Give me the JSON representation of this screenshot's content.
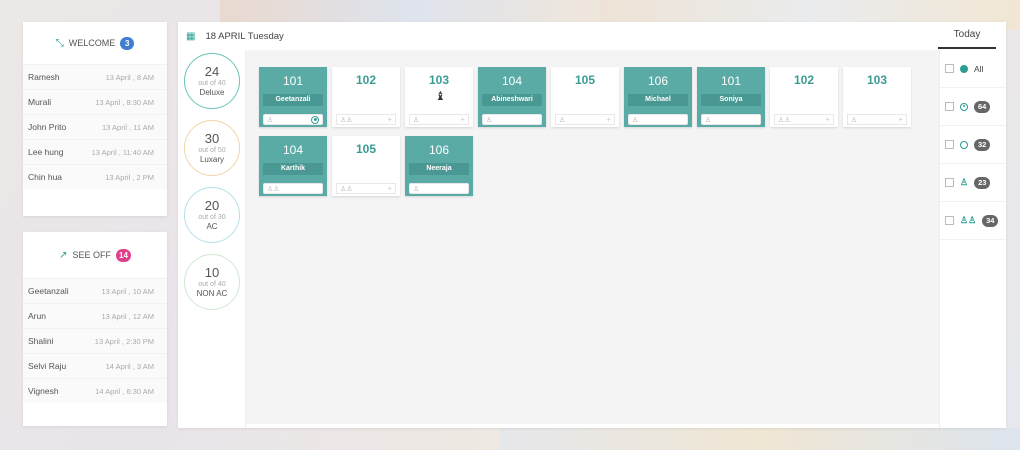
{
  "welcome": {
    "title": "WELCOME",
    "count": "3",
    "guests": [
      {
        "name": "Ramesh",
        "time": "13 April , 8 AM"
      },
      {
        "name": "Murali",
        "time": "13 April , 8:30 AM"
      },
      {
        "name": "John Prito",
        "time": "13 April , 11 AM"
      },
      {
        "name": "Lee hung",
        "time": "13 April , 11:40 AM"
      },
      {
        "name": "Chin hua",
        "time": "13 April , 2 PM"
      }
    ]
  },
  "seeoff": {
    "title": "SEE OFF",
    "count": "14",
    "guests": [
      {
        "name": "Geetanzali",
        "time": "13 April , 10 AM"
      },
      {
        "name": "Arun",
        "time": "13 April , 12 AM"
      },
      {
        "name": "Shalini",
        "time": "13 April , 2:30 PM"
      },
      {
        "name": "Selvi Raju",
        "time": "14 April , 3 AM"
      },
      {
        "name": "Vignesh",
        "time": "14 April , 6:30 AM"
      }
    ]
  },
  "header": {
    "date": "18 APRIL Tuesday",
    "today_tab": "Today"
  },
  "categories": [
    {
      "count": "24",
      "out_of": "out of 40",
      "name": "Deluxe"
    },
    {
      "count": "30",
      "out_of": "out of 50",
      "name": "Luxary"
    },
    {
      "count": "20",
      "out_of": "out of 30",
      "name": "AC"
    },
    {
      "count": "10",
      "out_of": "out of 40",
      "name": "NON AC"
    }
  ],
  "rooms_row1": [
    {
      "number": "101",
      "guest": "Geetanzali",
      "occupied": true
    },
    {
      "number": "102",
      "guest": "",
      "occupied": false
    },
    {
      "number": "103",
      "guest": "",
      "occupied": false
    },
    {
      "number": "104",
      "guest": "Abineshwari",
      "occupied": true
    },
    {
      "number": "105",
      "guest": "",
      "occupied": false
    },
    {
      "number": "106",
      "guest": "Michael",
      "occupied": true
    },
    {
      "number": "101",
      "guest": "Soniya",
      "occupied": true
    },
    {
      "number": "102",
      "guest": "",
      "occupied": false
    },
    {
      "number": "103",
      "guest": "",
      "occupied": false
    }
  ],
  "rooms_row2": [
    {
      "number": "104",
      "guest": "Karthik",
      "occupied": true
    },
    {
      "number": "105",
      "guest": "",
      "occupied": false
    },
    {
      "number": "106",
      "guest": "Neeraja",
      "occupied": true
    }
  ],
  "filters": [
    {
      "label": "All",
      "count": ""
    },
    {
      "label": "",
      "count": "64"
    },
    {
      "label": "",
      "count": "32"
    },
    {
      "label": "",
      "count": "23"
    },
    {
      "label": "",
      "count": "34"
    }
  ],
  "colors": {
    "accent": "#2a9d8f",
    "occupied": "#5aaba6",
    "welcome_badge": "#3f7fd1",
    "seeoff_badge": "#e0408a"
  }
}
